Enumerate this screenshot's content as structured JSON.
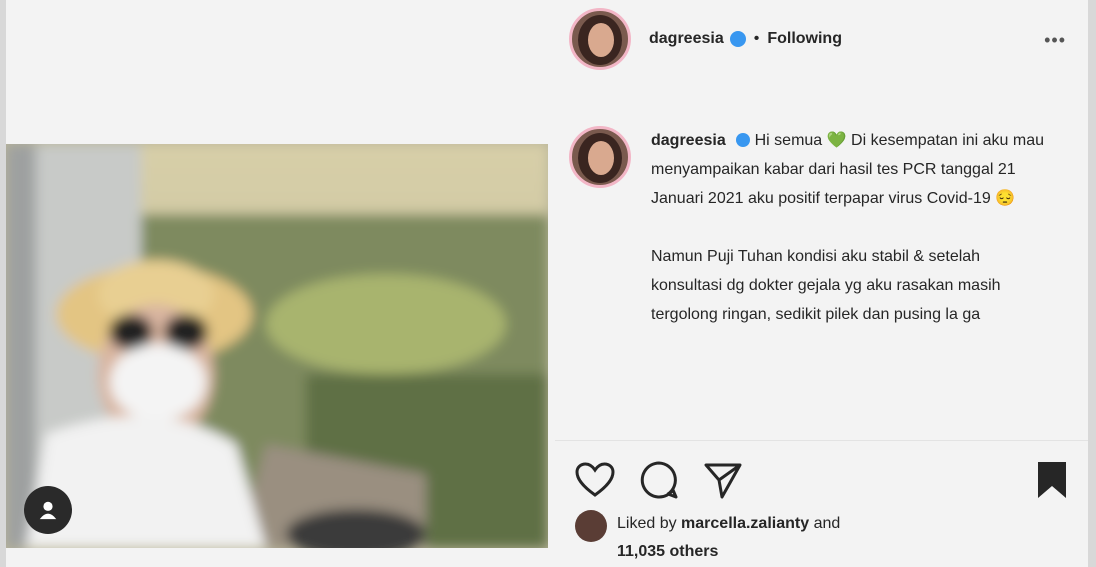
{
  "post": {
    "username": "dagreesia",
    "separator": "•",
    "follow_status": "Following",
    "more": "•••",
    "caption": {
      "username": "dagreesia",
      "greeting": "Hi semua",
      "greeting_emoji": "💚",
      "paragraph1": "Di kesempatan ini aku mau menyampaikan kabar dari hasil tes PCR tanggal 21 Januari 2021 aku positif terpapar virus Covid-19 😔",
      "paragraph2": "Namun Puji Tuhan kondisi aku stabil & setelah konsultasi dg dokter gejala yg aku rasakan masih tergolong ringan, sedikit pilek dan pusing la ga"
    },
    "likes": {
      "prefix": "Liked by",
      "liker": "marcella.zalianty",
      "middle": "and",
      "others": "11,035 others"
    }
  },
  "icons": {
    "verified": "verified-badge-icon",
    "like": "heart-outline-icon",
    "comment": "comment-bubble-icon",
    "share": "paper-plane-icon",
    "save": "bookmark-filled-icon",
    "tag": "person-tag-icon"
  },
  "colors": {
    "verified": "#3897f0",
    "story_ring": "#f2b6c6",
    "text": "#262626"
  }
}
